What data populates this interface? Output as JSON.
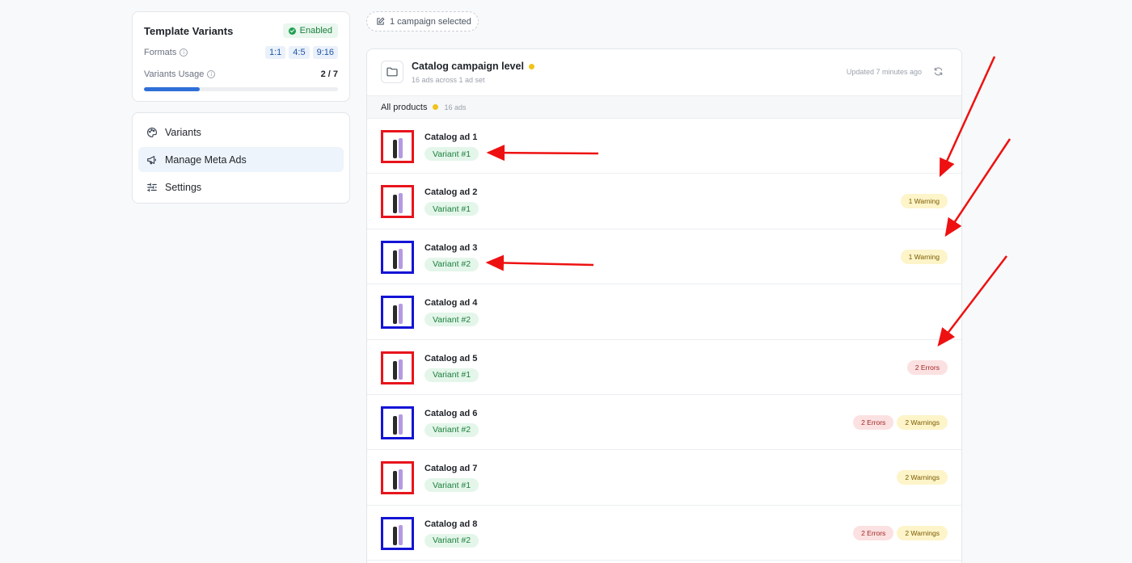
{
  "template_variants": {
    "title": "Template Variants",
    "status": "Enabled",
    "formats_label": "Formats",
    "formats": [
      "1:1",
      "4:5",
      "9:16"
    ],
    "usage_label": "Variants Usage",
    "usage_value": "2 / 7",
    "usage_fraction": 0.2857
  },
  "nav": {
    "items": [
      {
        "label": "Variants",
        "icon": "palette-icon",
        "active": false
      },
      {
        "label": "Manage Meta Ads",
        "icon": "megaphone-icon",
        "active": true
      },
      {
        "label": "Settings",
        "icon": "sliders-icon",
        "active": false
      }
    ]
  },
  "selection": {
    "label": "1 campaign selected"
  },
  "campaign": {
    "title": "Catalog campaign level",
    "subtitle": "16 ads across 1 ad set",
    "updated": "Updated 7 minutes ago"
  },
  "group": {
    "name": "All products",
    "count": "16 ads"
  },
  "ads": [
    {
      "name": "Catalog ad 1",
      "variant": "Variant #1",
      "thumb_color": "#e8141c",
      "statuses": []
    },
    {
      "name": "Catalog ad 2",
      "variant": "Variant #1",
      "thumb_color": "#e8141c",
      "statuses": [
        {
          "type": "warn",
          "label": "1 Warning"
        }
      ]
    },
    {
      "name": "Catalog ad 3",
      "variant": "Variant #2",
      "thumb_color": "#1414d6",
      "statuses": [
        {
          "type": "warn",
          "label": "1 Warning"
        }
      ]
    },
    {
      "name": "Catalog ad 4",
      "variant": "Variant #2",
      "thumb_color": "#1414d6",
      "statuses": []
    },
    {
      "name": "Catalog ad 5",
      "variant": "Variant #1",
      "thumb_color": "#e8141c",
      "statuses": [
        {
          "type": "err",
          "label": "2 Errors"
        }
      ]
    },
    {
      "name": "Catalog ad 6",
      "variant": "Variant #2",
      "thumb_color": "#1414d6",
      "statuses": [
        {
          "type": "err",
          "label": "2 Errors"
        },
        {
          "type": "warn",
          "label": "2 Warnings"
        }
      ]
    },
    {
      "name": "Catalog ad 7",
      "variant": "Variant #1",
      "thumb_color": "#e8141c",
      "statuses": [
        {
          "type": "warn",
          "label": "2 Warnings"
        }
      ]
    },
    {
      "name": "Catalog ad 8",
      "variant": "Variant #2",
      "thumb_color": "#1414d6",
      "statuses": [
        {
          "type": "err",
          "label": "2 Errors"
        },
        {
          "type": "warn",
          "label": "2 Warnings"
        }
      ]
    }
  ],
  "colors": {
    "annotation_arrow": "#ee1111",
    "accent": "#2f6fd8"
  }
}
